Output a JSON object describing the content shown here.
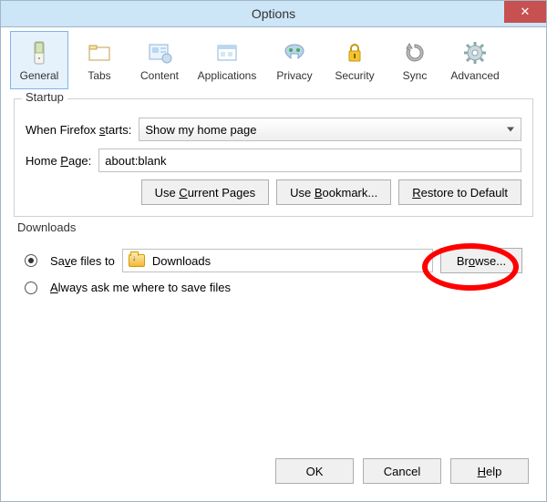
{
  "window": {
    "title": "Options"
  },
  "tabs": {
    "general": "General",
    "tabs": "Tabs",
    "content": "Content",
    "applications": "Applications",
    "privacy": "Privacy",
    "security": "Security",
    "sync": "Sync",
    "advanced": "Advanced"
  },
  "startup": {
    "legend": "Startup",
    "when_label_pre": "When Firefox ",
    "when_label_u": "s",
    "when_label_post": "tarts:",
    "when_value": "Show my home page",
    "home_label_pre": "Home ",
    "home_label_u": "P",
    "home_label_post": "age:",
    "home_value": "about:blank",
    "btn_current_pre": "Use ",
    "btn_current_u": "C",
    "btn_current_post": "urrent Pages",
    "btn_bookmark_pre": "Use ",
    "btn_bookmark_u": "B",
    "btn_bookmark_post": "ookmark...",
    "btn_restore_u": "R",
    "btn_restore_post": "estore to Default"
  },
  "downloads": {
    "legend": "Downloads",
    "save_pre": "Sa",
    "save_u": "v",
    "save_post": "e files to",
    "path": "Downloads",
    "browse_pre": "Br",
    "browse_u": "o",
    "browse_post": "wse...",
    "ask_u": "A",
    "ask_post": "lways ask me where to save files"
  },
  "footer": {
    "ok": "OK",
    "cancel": "Cancel",
    "help_u": "H",
    "help_post": "elp"
  }
}
